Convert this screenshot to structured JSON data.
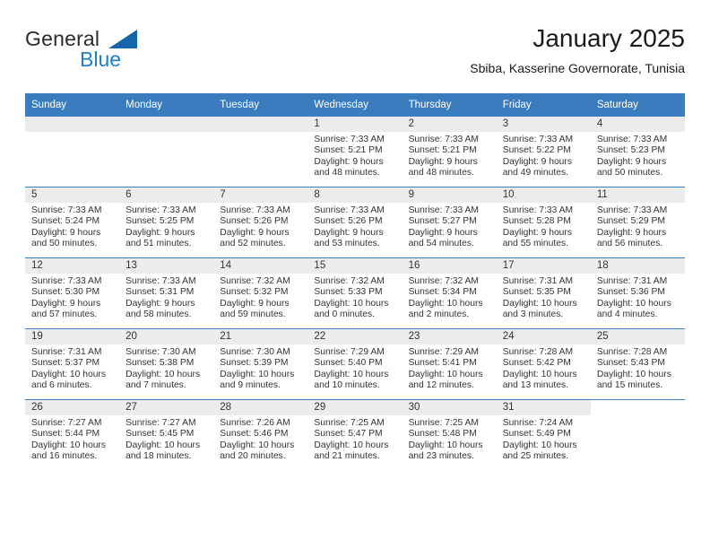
{
  "brand": {
    "name_top": "General",
    "name_bottom": "Blue",
    "accent_color": "#1f7dc4",
    "triangle_color": "#1565a8"
  },
  "header": {
    "title": "January 2025",
    "subtitle": "Sbiba, Kasserine Governorate, Tunisia"
  },
  "calendar": {
    "header_bg": "#3a7cbe",
    "header_text_color": "#ffffff",
    "daynum_band_bg": "#ececec",
    "weekdays": [
      "Sunday",
      "Monday",
      "Tuesday",
      "Wednesday",
      "Thursday",
      "Friday",
      "Saturday"
    ],
    "weeks": [
      [
        {
          "day": "",
          "empty": true
        },
        {
          "day": "",
          "empty": true
        },
        {
          "day": "",
          "empty": true
        },
        {
          "day": "1",
          "sunrise": "Sunrise: 7:33 AM",
          "sunset": "Sunset: 5:21 PM",
          "daylight1": "Daylight: 9 hours",
          "daylight2": "and 48 minutes."
        },
        {
          "day": "2",
          "sunrise": "Sunrise: 7:33 AM",
          "sunset": "Sunset: 5:21 PM",
          "daylight1": "Daylight: 9 hours",
          "daylight2": "and 48 minutes."
        },
        {
          "day": "3",
          "sunrise": "Sunrise: 7:33 AM",
          "sunset": "Sunset: 5:22 PM",
          "daylight1": "Daylight: 9 hours",
          "daylight2": "and 49 minutes."
        },
        {
          "day": "4",
          "sunrise": "Sunrise: 7:33 AM",
          "sunset": "Sunset: 5:23 PM",
          "daylight1": "Daylight: 9 hours",
          "daylight2": "and 50 minutes."
        }
      ],
      [
        {
          "day": "5",
          "sunrise": "Sunrise: 7:33 AM",
          "sunset": "Sunset: 5:24 PM",
          "daylight1": "Daylight: 9 hours",
          "daylight2": "and 50 minutes."
        },
        {
          "day": "6",
          "sunrise": "Sunrise: 7:33 AM",
          "sunset": "Sunset: 5:25 PM",
          "daylight1": "Daylight: 9 hours",
          "daylight2": "and 51 minutes."
        },
        {
          "day": "7",
          "sunrise": "Sunrise: 7:33 AM",
          "sunset": "Sunset: 5:26 PM",
          "daylight1": "Daylight: 9 hours",
          "daylight2": "and 52 minutes."
        },
        {
          "day": "8",
          "sunrise": "Sunrise: 7:33 AM",
          "sunset": "Sunset: 5:26 PM",
          "daylight1": "Daylight: 9 hours",
          "daylight2": "and 53 minutes."
        },
        {
          "day": "9",
          "sunrise": "Sunrise: 7:33 AM",
          "sunset": "Sunset: 5:27 PM",
          "daylight1": "Daylight: 9 hours",
          "daylight2": "and 54 minutes."
        },
        {
          "day": "10",
          "sunrise": "Sunrise: 7:33 AM",
          "sunset": "Sunset: 5:28 PM",
          "daylight1": "Daylight: 9 hours",
          "daylight2": "and 55 minutes."
        },
        {
          "day": "11",
          "sunrise": "Sunrise: 7:33 AM",
          "sunset": "Sunset: 5:29 PM",
          "daylight1": "Daylight: 9 hours",
          "daylight2": "and 56 minutes."
        }
      ],
      [
        {
          "day": "12",
          "sunrise": "Sunrise: 7:33 AM",
          "sunset": "Sunset: 5:30 PM",
          "daylight1": "Daylight: 9 hours",
          "daylight2": "and 57 minutes."
        },
        {
          "day": "13",
          "sunrise": "Sunrise: 7:33 AM",
          "sunset": "Sunset: 5:31 PM",
          "daylight1": "Daylight: 9 hours",
          "daylight2": "and 58 minutes."
        },
        {
          "day": "14",
          "sunrise": "Sunrise: 7:32 AM",
          "sunset": "Sunset: 5:32 PM",
          "daylight1": "Daylight: 9 hours",
          "daylight2": "and 59 minutes."
        },
        {
          "day": "15",
          "sunrise": "Sunrise: 7:32 AM",
          "sunset": "Sunset: 5:33 PM",
          "daylight1": "Daylight: 10 hours",
          "daylight2": "and 0 minutes."
        },
        {
          "day": "16",
          "sunrise": "Sunrise: 7:32 AM",
          "sunset": "Sunset: 5:34 PM",
          "daylight1": "Daylight: 10 hours",
          "daylight2": "and 2 minutes."
        },
        {
          "day": "17",
          "sunrise": "Sunrise: 7:31 AM",
          "sunset": "Sunset: 5:35 PM",
          "daylight1": "Daylight: 10 hours",
          "daylight2": "and 3 minutes."
        },
        {
          "day": "18",
          "sunrise": "Sunrise: 7:31 AM",
          "sunset": "Sunset: 5:36 PM",
          "daylight1": "Daylight: 10 hours",
          "daylight2": "and 4 minutes."
        }
      ],
      [
        {
          "day": "19",
          "sunrise": "Sunrise: 7:31 AM",
          "sunset": "Sunset: 5:37 PM",
          "daylight1": "Daylight: 10 hours",
          "daylight2": "and 6 minutes."
        },
        {
          "day": "20",
          "sunrise": "Sunrise: 7:30 AM",
          "sunset": "Sunset: 5:38 PM",
          "daylight1": "Daylight: 10 hours",
          "daylight2": "and 7 minutes."
        },
        {
          "day": "21",
          "sunrise": "Sunrise: 7:30 AM",
          "sunset": "Sunset: 5:39 PM",
          "daylight1": "Daylight: 10 hours",
          "daylight2": "and 9 minutes."
        },
        {
          "day": "22",
          "sunrise": "Sunrise: 7:29 AM",
          "sunset": "Sunset: 5:40 PM",
          "daylight1": "Daylight: 10 hours",
          "daylight2": "and 10 minutes."
        },
        {
          "day": "23",
          "sunrise": "Sunrise: 7:29 AM",
          "sunset": "Sunset: 5:41 PM",
          "daylight1": "Daylight: 10 hours",
          "daylight2": "and 12 minutes."
        },
        {
          "day": "24",
          "sunrise": "Sunrise: 7:28 AM",
          "sunset": "Sunset: 5:42 PM",
          "daylight1": "Daylight: 10 hours",
          "daylight2": "and 13 minutes."
        },
        {
          "day": "25",
          "sunrise": "Sunrise: 7:28 AM",
          "sunset": "Sunset: 5:43 PM",
          "daylight1": "Daylight: 10 hours",
          "daylight2": "and 15 minutes."
        }
      ],
      [
        {
          "day": "26",
          "sunrise": "Sunrise: 7:27 AM",
          "sunset": "Sunset: 5:44 PM",
          "daylight1": "Daylight: 10 hours",
          "daylight2": "and 16 minutes."
        },
        {
          "day": "27",
          "sunrise": "Sunrise: 7:27 AM",
          "sunset": "Sunset: 5:45 PM",
          "daylight1": "Daylight: 10 hours",
          "daylight2": "and 18 minutes."
        },
        {
          "day": "28",
          "sunrise": "Sunrise: 7:26 AM",
          "sunset": "Sunset: 5:46 PM",
          "daylight1": "Daylight: 10 hours",
          "daylight2": "and 20 minutes."
        },
        {
          "day": "29",
          "sunrise": "Sunrise: 7:25 AM",
          "sunset": "Sunset: 5:47 PM",
          "daylight1": "Daylight: 10 hours",
          "daylight2": "and 21 minutes."
        },
        {
          "day": "30",
          "sunrise": "Sunrise: 7:25 AM",
          "sunset": "Sunset: 5:48 PM",
          "daylight1": "Daylight: 10 hours",
          "daylight2": "and 23 minutes."
        },
        {
          "day": "31",
          "sunrise": "Sunrise: 7:24 AM",
          "sunset": "Sunset: 5:49 PM",
          "daylight1": "Daylight: 10 hours",
          "daylight2": "and 25 minutes."
        },
        {
          "day": "",
          "empty": true,
          "blank": true
        }
      ]
    ]
  }
}
